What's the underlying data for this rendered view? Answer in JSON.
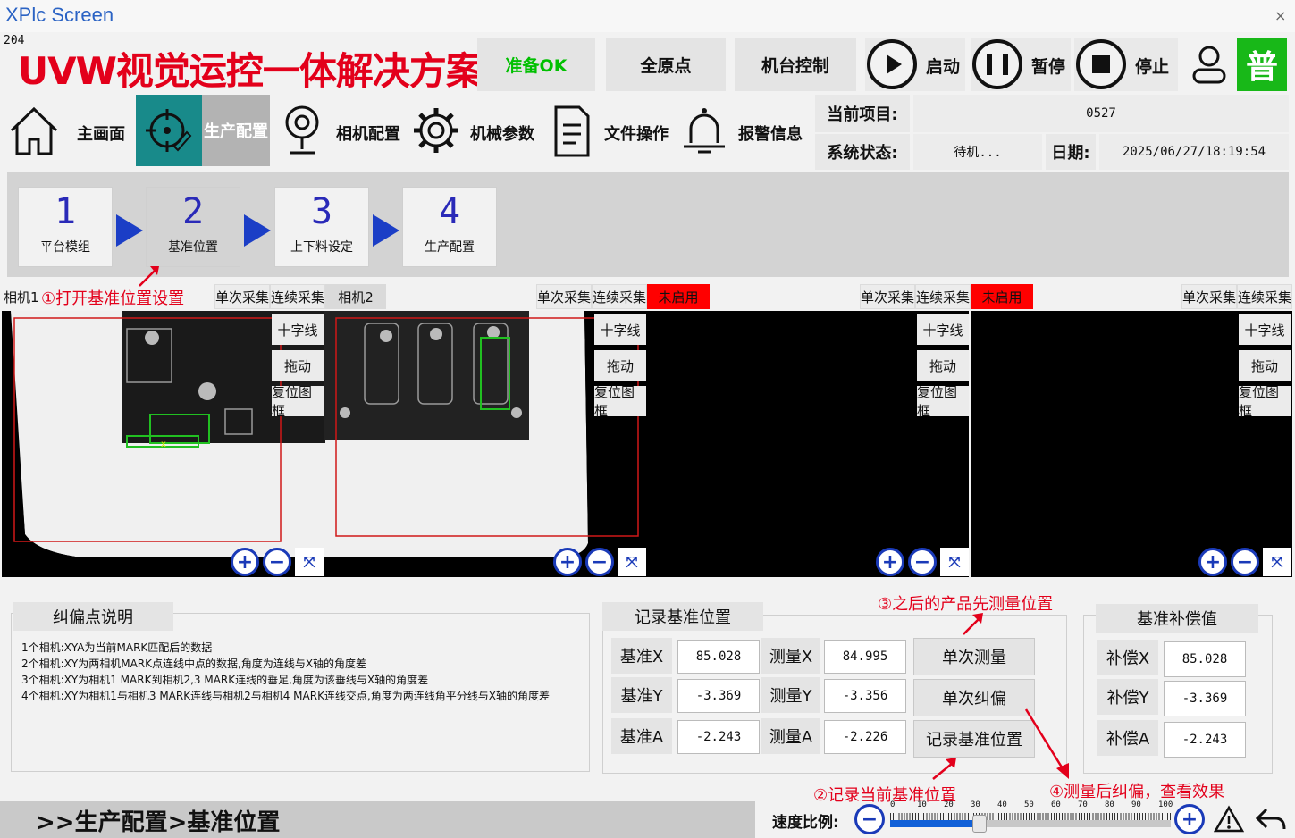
{
  "window": {
    "title": "XPlc Screen",
    "close_glyph": "×",
    "counter": "204"
  },
  "brand": "UVW视觉运控一体解决方案",
  "top_buttons": {
    "ready": {
      "label": "准备OK",
      "color": "#00c000"
    },
    "home_all": "全原点",
    "machine_control": "机台控制",
    "start": "启动",
    "pause": "暂停",
    "stop": "停止",
    "user_level": "普"
  },
  "nav": [
    {
      "label": "主画面",
      "icon": "home-icon"
    },
    {
      "label": "生产配置",
      "icon": "target-icon",
      "active": true
    },
    {
      "label": "相机配置",
      "icon": "camera-icon"
    },
    {
      "label": "机械参数",
      "icon": "gear-icon"
    },
    {
      "label": "文件操作",
      "icon": "file-icon"
    },
    {
      "label": "报警信息",
      "icon": "bell-icon"
    }
  ],
  "info": {
    "project_label": "当前项目:",
    "project_value": "0527",
    "status_label": "系统状态:",
    "status_value": "待机...",
    "date_label": "日期:",
    "date_value": "2025/06/27/18:19:54"
  },
  "steps": [
    {
      "num": "1",
      "label": "平台模组"
    },
    {
      "num": "2",
      "label": "基准位置",
      "active": true
    },
    {
      "num": "3",
      "label": "上下料设定"
    },
    {
      "num": "4",
      "label": "生产配置"
    }
  ],
  "cameras": {
    "cam1_label": "相机1",
    "cam2_label": "相机2",
    "single_capture": "单次采集",
    "continuous_capture": "连续采集",
    "not_enabled": "未启用",
    "crosshair": "十字线",
    "drag": "拖动",
    "reset_frame": "复位图框"
  },
  "annotations": {
    "a1": "①打开基准位置设置",
    "a2": "②记录当前基准位置",
    "a3": "③之后的产品先测量位置",
    "a4": "④测量后纠偏，查看效果"
  },
  "description": {
    "title": "纠偏点说明",
    "lines": [
      "1个相机:XYA为当前MARK匹配后的数据",
      "2个相机:XY为两相机MARK点连线中点的数据,角度为连线与X轴的角度差",
      "3个相机:XY为相机1 MARK到相机2,3 MARK连线的垂足,角度为该垂线与X轴的角度差",
      "4个相机:XY为相机1与相机3 MARK连线与相机2与相机4 MARK连线交点,角度为两连线角平分线与X轴的角度差"
    ]
  },
  "record": {
    "title": "记录基准位置",
    "base_x_label": "基准X",
    "base_x": "85.028",
    "base_y_label": "基准Y",
    "base_y": "-3.369",
    "base_a_label": "基准A",
    "base_a": "-2.243",
    "meas_x_label": "测量X",
    "meas_x": "84.995",
    "meas_y_label": "测量Y",
    "meas_y": "-3.356",
    "meas_a_label": "测量A",
    "meas_a": "-2.226",
    "single_measure": "单次测量",
    "single_correct": "单次纠偏",
    "record_base": "记录基准位置"
  },
  "compensation": {
    "title": "基准补偿值",
    "x_label": "补偿X",
    "x": "85.028",
    "y_label": "补偿Y",
    "y": "-3.369",
    "a_label": "补偿A",
    "a": "-2.243"
  },
  "footer": {
    "breadcrumb": ">>生产配置>基准位置",
    "speed_label": "速度比例:",
    "speed_ticks": [
      "0",
      "10",
      "20",
      "30",
      "40",
      "50",
      "60",
      "70",
      "80",
      "90",
      "100"
    ],
    "speed_value": 30
  }
}
